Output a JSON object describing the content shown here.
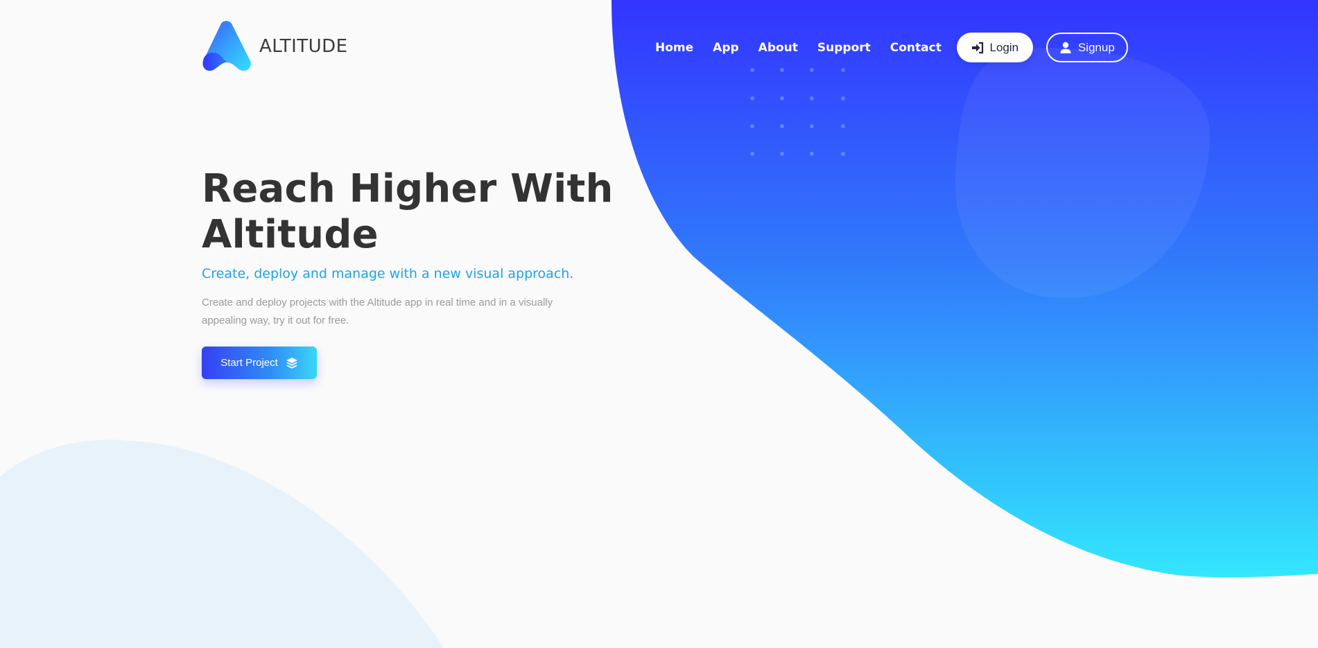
{
  "brand": {
    "name": "ALTITUDE",
    "logo_icon": "altitude-a-logo",
    "gradient_start": "#3335fe",
    "gradient_end": "#33e6fd"
  },
  "nav": {
    "items": [
      "Home",
      "App",
      "About",
      "Support",
      "Contact"
    ],
    "login_label": "Login",
    "login_icon": "sign-in-icon",
    "signup_label": "Signup",
    "signup_icon": "user-icon"
  },
  "hero": {
    "title_line1": "Reach Higher With",
    "title_line2": "Altitude",
    "subtitle": "Create, deploy and manage with a new visual approach.",
    "description": "Create and deploy projects with the Altitude app in real time and in a visually appealing way, try it out for free.",
    "cta_label": "Start Project",
    "cta_icon": "layers-icon"
  },
  "colors": {
    "title": "#333333",
    "subtitle": "#1ea3e6",
    "description": "#9a9a9a",
    "background": "#fafafb",
    "light_blob": "#e8f2fb"
  }
}
